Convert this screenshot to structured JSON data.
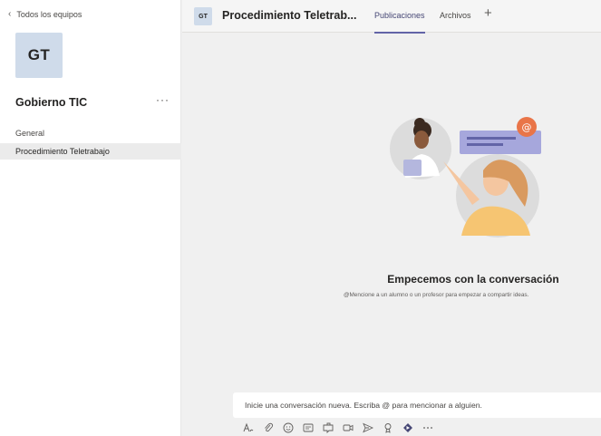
{
  "sidebar": {
    "back_label": "Todos los equipos",
    "team_initials": "GT",
    "team_name": "Gobierno TIC",
    "more_label": "···",
    "channels": [
      {
        "label": "General"
      },
      {
        "label": "Procedimiento Teletrabajo"
      }
    ]
  },
  "header": {
    "avatar_initials": "GT",
    "title": "Procedimiento Teletrab...",
    "tabs": [
      {
        "label": "Publicaciones"
      },
      {
        "label": "Archivos"
      }
    ],
    "add_tab": "+"
  },
  "main": {
    "empty_title": "Empecemos con la conversación",
    "empty_subtitle": "@Mencione a un alumno o un profesor para empezar a compartir ideas.",
    "compose_placeholder": "Inicie una conversación nueva. Escriba @ para mencionar a alguien.",
    "toolbar_icons": [
      "format-icon",
      "attach-icon",
      "emoji-icon",
      "gif-icon",
      "sticker-icon",
      "meet-icon",
      "send-icon",
      "praise-icon",
      "stream-icon",
      "more-icon"
    ]
  },
  "colors": {
    "accent": "#6264a7",
    "avatar_bg": "#cfdbea",
    "canvas_bg": "#f0f0f0"
  }
}
